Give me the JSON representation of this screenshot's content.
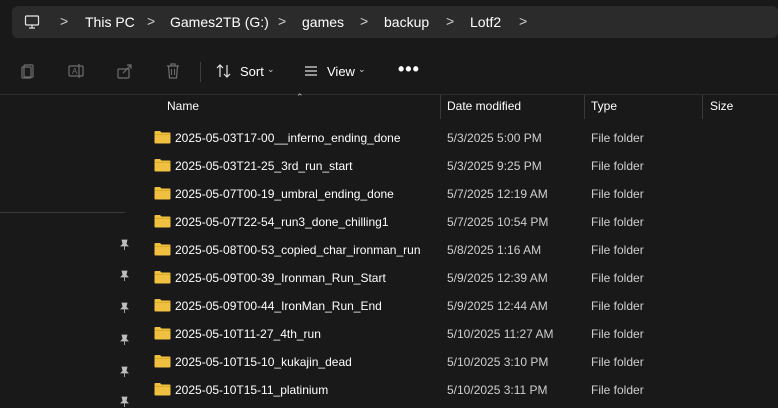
{
  "address_bar": {
    "breadcrumbs": [
      "This PC",
      "Games2TB (G:)",
      "games",
      "backup",
      "Lotf2"
    ],
    "separator": ">"
  },
  "toolbar": {
    "sort_label": "Sort",
    "view_label": "View",
    "more_label": "•••",
    "icons": [
      "copy-icon",
      "rename-icon",
      "share-icon",
      "delete-icon",
      "sort-icon",
      "view-icon"
    ]
  },
  "columns": {
    "name": "Name",
    "date": "Date modified",
    "type": "Type",
    "size": "Size"
  },
  "rows": [
    {
      "name": "2025-05-03T17-00__inferno_ending_done",
      "date": "5/3/2025 5:00 PM",
      "type": "File folder"
    },
    {
      "name": "2025-05-03T21-25_3rd_run_start",
      "date": "5/3/2025 9:25 PM",
      "type": "File folder"
    },
    {
      "name": "2025-05-07T00-19_umbral_ending_done",
      "date": "5/7/2025 12:19 AM",
      "type": "File folder"
    },
    {
      "name": "2025-05-07T22-54_run3_done_chilling1",
      "date": "5/7/2025 10:54 PM",
      "type": "File folder"
    },
    {
      "name": "2025-05-08T00-53_copied_char_ironman_run",
      "date": "5/8/2025 1:16 AM",
      "type": "File folder"
    },
    {
      "name": "2025-05-09T00-39_Ironman_Run_Start",
      "date": "5/9/2025 12:39 AM",
      "type": "File folder"
    },
    {
      "name": "2025-05-09T00-44_IronMan_Run_End",
      "date": "5/9/2025 12:44 AM",
      "type": "File folder"
    },
    {
      "name": "2025-05-10T11-27_4th_run",
      "date": "5/10/2025 11:27 AM",
      "type": "File folder"
    },
    {
      "name": "2025-05-10T15-10_kukajin_dead",
      "date": "5/10/2025 3:10 PM",
      "type": "File folder"
    },
    {
      "name": "2025-05-10T15-11_platinium",
      "date": "5/10/2025 3:11 PM",
      "type": "File folder"
    }
  ],
  "colors": {
    "folder": "#f0c040",
    "background": "#191919",
    "address_bar": "#2b2b2b"
  }
}
